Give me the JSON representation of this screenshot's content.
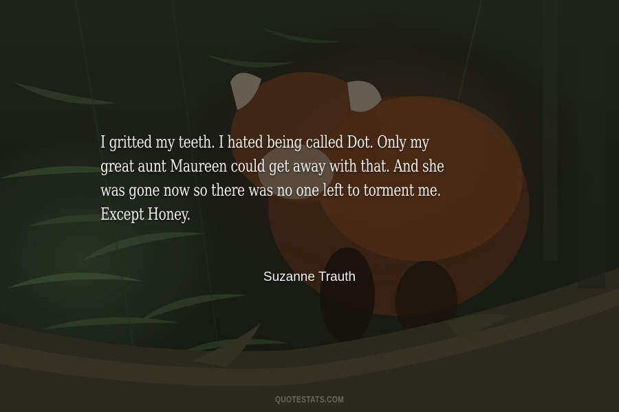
{
  "quote": {
    "lines": [
      "I gritted my teeth. I hated being called Dot. Only my",
      "great aunt Maureen could get away with that. And she",
      "was gone now so there was no one left to torment me.",
      "Except Honey."
    ]
  },
  "author": "Suzanne Trauth",
  "watermark": "QUOTESTATS.COM",
  "background": {
    "subject": "red panda on a tree branch among bamboo leaves",
    "colors": {
      "fur": "#6a3a1f",
      "foliage": "#3f5234",
      "branch": "#4a4535",
      "backdrop": "#242a1f"
    }
  }
}
